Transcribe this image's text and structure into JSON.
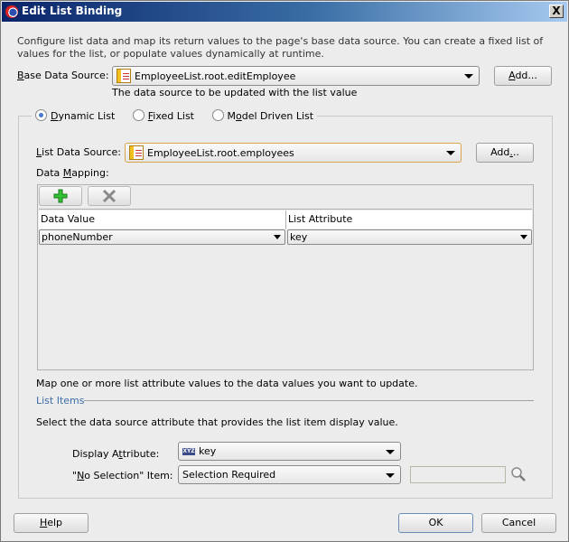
{
  "window": {
    "title": "Edit List Binding",
    "close_label": "X"
  },
  "description": "Configure list data and map its return values to the page's base data source. You can create a fixed list of values for the list, or populate values dynamically at runtime.",
  "base_data_source": {
    "label_prefix": "B",
    "label_rest": "ase Data Source:",
    "value": "EmployeeList.root.editEmployee",
    "hint": "The data source to be updated with the list value",
    "add_label_prefix": "A",
    "add_label_rest": "dd..."
  },
  "list_type": {
    "options": [
      {
        "u": "D",
        "rest": "ynamic List",
        "selected": true
      },
      {
        "u": "F",
        "rest": "ixed List",
        "selected": false
      },
      {
        "pre": "M",
        "u": "o",
        "rest": "del Driven List",
        "selected": false
      }
    ]
  },
  "list_data_source": {
    "label_prefix": "L",
    "label_rest": "ist Data Source:",
    "value": "EmployeeList.root.employees",
    "add_label_pre": "Add",
    "add_label_u": ".",
    "add_label_rest": ".."
  },
  "data_mapping": {
    "label_pre": "Data ",
    "label_u": "M",
    "label_rest": "apping:",
    "add_icon": "plus-icon",
    "remove_icon": "delete-icon",
    "columns": [
      "Data Value",
      "List Attribute"
    ],
    "rows": [
      {
        "data_value": "phoneNumber",
        "list_attribute": "key"
      }
    ],
    "hint": "Map one or more list attribute values to the data values you want to update."
  },
  "list_items": {
    "section_title": "List Items",
    "hint": "Select the data source attribute that provides the list item display value.",
    "display_attribute": {
      "label_pre": "Display A",
      "label_u": "t",
      "label_rest": "tribute:",
      "value": "key"
    },
    "no_selection": {
      "label_pre": "\"",
      "label_u": "N",
      "label_rest": "o Selection\" Item:",
      "value": "Selection Required",
      "text_value": ""
    }
  },
  "footer": {
    "help_u": "H",
    "help_rest": "elp",
    "ok_label": "OK",
    "cancel_label": "Cancel"
  }
}
